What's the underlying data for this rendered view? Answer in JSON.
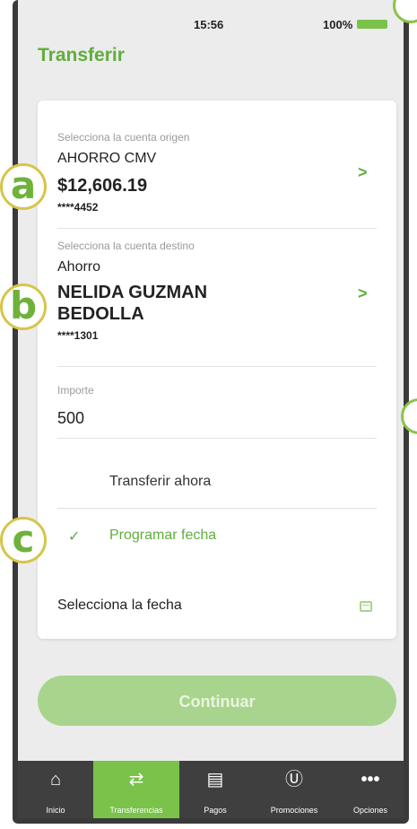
{
  "status": {
    "time": "15:56",
    "battery": "100%"
  },
  "header": {
    "title": "Transferir"
  },
  "origin": {
    "label": "Selecciona la cuenta origen",
    "name": "AHORRO CMV",
    "balance": "$12,606.19",
    "number": "****4452"
  },
  "destination": {
    "label": "Selecciona la cuenta destino",
    "type": "Ahorro",
    "name_line1": "NELIDA GUZMAN",
    "name_line2": "BEDOLLA",
    "number": "****1301"
  },
  "amount": {
    "label": "Importe",
    "value": "500"
  },
  "options": {
    "now": "Transferir ahora",
    "schedule": "Programar fecha",
    "selected": "schedule"
  },
  "date": {
    "label": "Selecciona la fecha"
  },
  "continue_label": "Continuar",
  "tabs": [
    {
      "label": "Inicio",
      "icon": "home-icon"
    },
    {
      "label": "Transferencias",
      "icon": "transfer-icon",
      "active": true
    },
    {
      "label": "Pagos",
      "icon": "payments-icon"
    },
    {
      "label": "Promociones",
      "icon": "dollar-circle-icon"
    },
    {
      "label": "Opciones",
      "icon": "more-icon"
    }
  ],
  "markers": [
    "a",
    "b",
    "c"
  ],
  "colors": {
    "accent": "#7ac24a",
    "title": "#5fae3c",
    "button": "#a9d48d",
    "tabbar": "#3f3f3f"
  }
}
